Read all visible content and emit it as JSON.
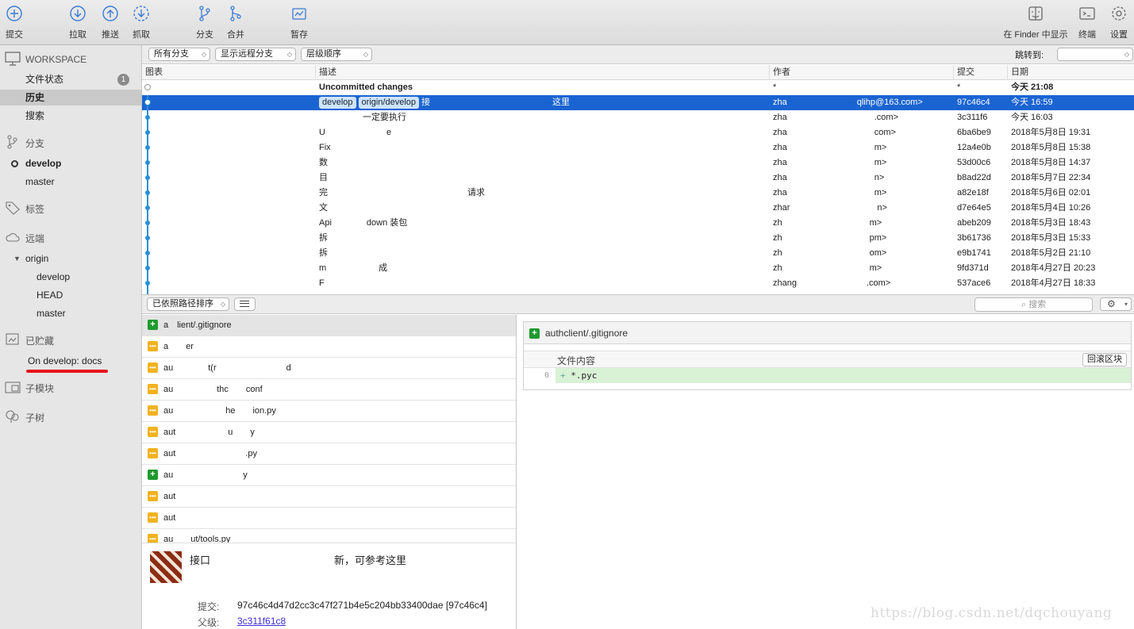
{
  "toolbar": {
    "commit": "提交",
    "pull": "拉取",
    "push": "推送",
    "fetch": "抓取",
    "branch": "分支",
    "merge": "合并",
    "stash": "暂存",
    "finder": "在 Finder 中显示",
    "terminal": "终端",
    "settings": "设置"
  },
  "sidebar": {
    "workspace": "WORKSPACE",
    "file_status": "文件状态",
    "file_status_count": "1",
    "history": "历史",
    "search": "搜索",
    "branches": "分支",
    "branch_items": [
      "develop",
      "master"
    ],
    "tags": "标签",
    "remotes": "远端",
    "remote_name": "origin",
    "remote_items": [
      "develop",
      "HEAD",
      "master"
    ],
    "stashes": "已贮藏",
    "stash_item": "On develop: docs",
    "submodules": "子模块",
    "subtrees": "子树"
  },
  "filterbar": {
    "branches": "所有分支",
    "remote": "显示远程分支",
    "order": "层级顺序",
    "jump_to": "跳转到:"
  },
  "table": {
    "headers": {
      "graph": "图表",
      "desc": "描述",
      "author": "作者",
      "commit": "提交",
      "date": "日期"
    },
    "tags": [
      "develop",
      "origin/develop"
    ],
    "rows": [
      {
        "desc": "Uncommitted changes",
        "author": "*",
        "hash": "*",
        "date": "今天 21:08"
      },
      {
        "desc": "接　　　　　　　　　　　　　　这里",
        "author": "zha　　　　　　　　qlihp@163.com>",
        "hash": "97c46c4",
        "date": "今天 16:59"
      },
      {
        "desc": "　　　　　一定要执行",
        "author": "zha　　　　　　　　　　.com>",
        "hash": "3c311f6",
        "date": "今天 16:03"
      },
      {
        "desc": "U　　　　　　　e",
        "author": "zha　　　　　　　　　　com>",
        "hash": "6ba6be9",
        "date": "2018年5月8日 19:31"
      },
      {
        "desc": "Fix　　　　　　　",
        "author": "zha　　　　　　　　　　m>",
        "hash": "12a4e0b",
        "date": "2018年5月8日 15:38"
      },
      {
        "desc": "数",
        "author": "zha　　　　　　　　　　m>",
        "hash": "53d00c6",
        "date": "2018年5月8日 14:37"
      },
      {
        "desc": "目",
        "author": "zha　　　　　　　　　　n>",
        "hash": "b8ad22d",
        "date": "2018年5月7日 22:34"
      },
      {
        "desc": "完　　　　　　　　　　　　　　　　请求",
        "author": "zha　　　　　　　　　　m>",
        "hash": "a82e18f",
        "date": "2018年5月6日 02:01"
      },
      {
        "desc": "文",
        "author": "zhar　　　　　　　　　　n>",
        "hash": "d7e64e5",
        "date": "2018年5月4日 10:26"
      },
      {
        "desc": "Api　　　　down 装包",
        "author": "zh　　　　　　　　　　m>",
        "hash": "abeb209",
        "date": "2018年5月3日 18:43"
      },
      {
        "desc": "拆",
        "author": "zh　　　　　　　　　　pm>",
        "hash": "3b61736",
        "date": "2018年5月3日 15:33"
      },
      {
        "desc": "拆",
        "author": "zh　　　　　　　　　　om>",
        "hash": "e9b1741",
        "date": "2018年5月2日 21:10"
      },
      {
        "desc": "m　　　　　　成",
        "author": "zh　　　　　　　　　　m>",
        "hash": "9fd371d",
        "date": "2018年4月27日 20:23"
      },
      {
        "desc": "F",
        "author": "zhang　　　　　　　　.com>",
        "hash": "537ace6",
        "date": "2018年4月27日 18:33"
      }
    ]
  },
  "midbar": {
    "sort": "已依照路径排序",
    "search_placeholder": "搜索"
  },
  "files": [
    {
      "status": "add",
      "path": "a　lient/.gitignore"
    },
    {
      "status": "mod",
      "path": "a　　er"
    },
    {
      "status": "mod",
      "path": "au　　　　t(r　　　　　　　　d"
    },
    {
      "status": "mod",
      "path": "au　　　　　thc　　conf"
    },
    {
      "status": "mod",
      "path": "au　　　　　　he　　ion.py"
    },
    {
      "status": "mod",
      "path": "aut　　　　　　u　　y"
    },
    {
      "status": "mod",
      "path": "aut　　　　　　　　.py"
    },
    {
      "status": "add",
      "path": "au　　　　　　　　y"
    },
    {
      "status": "mod",
      "path": "aut　　　　　　　　"
    },
    {
      "status": "mod",
      "path": "aut"
    },
    {
      "status": "mod",
      "path": "au　　ut/tools.py"
    }
  ],
  "detail": {
    "message": "接口　　　　　　　　　　　　新，可参考这里",
    "commit_label": "提交:",
    "commit_value": "97c46c4d47d2cc3c47f271b4e5c204bb33400dae [97c46c4]",
    "parent_label": "父级:",
    "parent_value": "3c311f61c8"
  },
  "diff": {
    "file": "authclient/.gitignore",
    "hunk_title": "文件内容",
    "revert_button": "回滚区块",
    "line_number": "0",
    "line_text": "*.pyc"
  },
  "watermark": "https://blog.csdn.net/dqchouyang",
  "colors": {
    "selection": "#1a64d2",
    "graph": "#2a8fd6",
    "added": "#1f9a2e",
    "modified": "#f2b21e",
    "stash_underline": "#e8141a"
  }
}
